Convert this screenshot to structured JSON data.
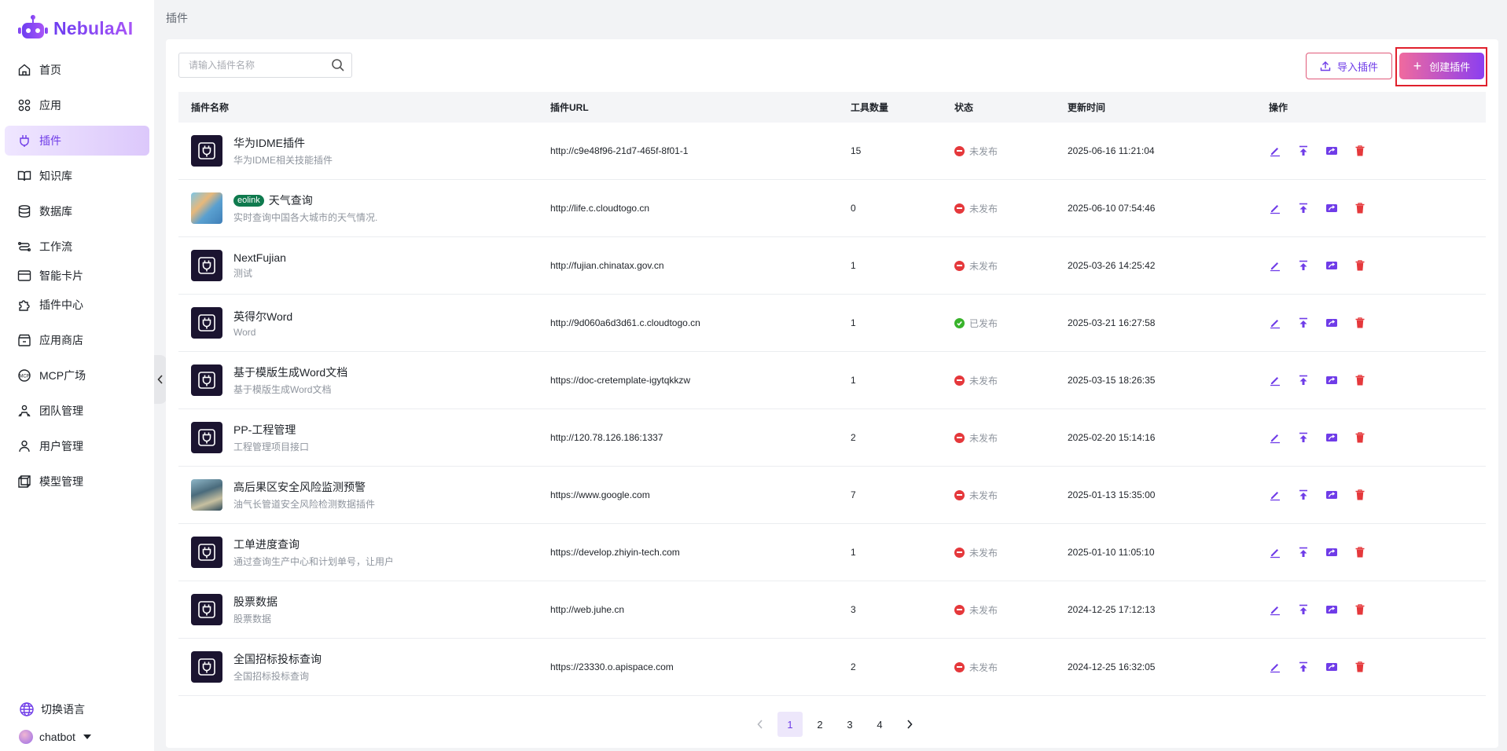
{
  "app": {
    "logo_text": "NebulaAI",
    "breadcrumb": "插件"
  },
  "sidebar": {
    "items": [
      {
        "label": "首页",
        "icon": "home-icon"
      },
      {
        "label": "应用",
        "icon": "apps-icon"
      },
      {
        "label": "插件",
        "icon": "plugin-icon",
        "active": true
      },
      {
        "label": "知识库",
        "icon": "book-icon"
      },
      {
        "label": "数据库",
        "icon": "database-icon"
      },
      {
        "label": "工作流",
        "icon": "workflow-icon"
      },
      {
        "label": "智能卡片",
        "icon": "card-icon"
      },
      {
        "label": "插件中心",
        "icon": "puzzle-icon"
      },
      {
        "label": "应用商店",
        "icon": "store-icon"
      },
      {
        "label": "MCP广场",
        "icon": "mcp-icon"
      },
      {
        "label": "团队管理",
        "icon": "team-icon"
      },
      {
        "label": "用户管理",
        "icon": "user-icon"
      },
      {
        "label": "模型管理",
        "icon": "model-icon"
      }
    ],
    "language": "切换语言",
    "user": "chatbot"
  },
  "toolbar": {
    "search_placeholder": "请输入插件名称",
    "import_label": "导入插件",
    "create_label": "创建插件"
  },
  "table": {
    "headers": {
      "name": "插件名称",
      "url": "插件URL",
      "tools": "工具数量",
      "status": "状态",
      "updated": "更新时间",
      "ops": "操作"
    },
    "rows": [
      {
        "title": "华为IDME插件",
        "desc": "华为IDME相关技能插件",
        "url": "http://c9e48f96-21d7-465f-8f01-1",
        "tools": "15",
        "status": "未发布",
        "published": false,
        "updated": "2025-06-16 11:21:04",
        "icon": "plugin"
      },
      {
        "title": "天气查询",
        "tag": "eolink",
        "desc": "实时查询中国各大城市的天气情况.",
        "url": "http://life.c.cloudtogo.cn",
        "tools": "0",
        "status": "未发布",
        "published": false,
        "updated": "2025-06-10 07:54:46",
        "icon": "weather"
      },
      {
        "title": "NextFujian",
        "desc": "测试",
        "url": "http://fujian.chinatax.gov.cn",
        "tools": "1",
        "status": "未发布",
        "published": false,
        "updated": "2025-03-26 14:25:42",
        "icon": "plugin"
      },
      {
        "title": "英得尔Word",
        "desc": "Word",
        "url": "http://9d060a6d3d61.c.cloudtogo.cn",
        "tools": "1",
        "status": "已发布",
        "published": true,
        "updated": "2025-03-21 16:27:58",
        "icon": "plugin"
      },
      {
        "title": "基于模版生成Word文档",
        "desc": "基于模版生成Word文档",
        "url": "https://doc-cretemplate-igytqkkzw",
        "tools": "1",
        "status": "未发布",
        "published": false,
        "updated": "2025-03-15 18:26:35",
        "icon": "plugin"
      },
      {
        "title": "PP-工程管理",
        "desc": "工程管理项目接口",
        "url": "http://120.78.126.186:1337",
        "tools": "2",
        "status": "未发布",
        "published": false,
        "updated": "2025-02-20 15:14:16",
        "icon": "plugin"
      },
      {
        "title": "高后果区安全风险监测预警",
        "desc": "油气长管道安全风险检测数据插件",
        "url": "https://www.google.com",
        "tools": "7",
        "status": "未发布",
        "published": false,
        "updated": "2025-01-13 15:35:00",
        "icon": "safety"
      },
      {
        "title": "工单进度查询",
        "desc": "通过查询生产中心和计划单号，让用户",
        "url": "https://develop.zhiyin-tech.com",
        "tools": "1",
        "status": "未发布",
        "published": false,
        "updated": "2025-01-10 11:05:10",
        "icon": "plugin"
      },
      {
        "title": "股票数据",
        "desc": "股票数据",
        "url": "http://web.juhe.cn",
        "tools": "3",
        "status": "未发布",
        "published": false,
        "updated": "2024-12-25 17:12:13",
        "icon": "plugin"
      },
      {
        "title": "全国招标投标查询",
        "desc": "全国招标投标查询",
        "url": "https://23330.o.apispace.com",
        "tools": "2",
        "status": "未发布",
        "published": false,
        "updated": "2024-12-25 16:32:05",
        "icon": "plugin"
      }
    ]
  },
  "pagination": {
    "pages": [
      "1",
      "2",
      "3",
      "4"
    ],
    "current": "1"
  },
  "colors": {
    "accent": "#6f3ce8",
    "danger": "#e5383b",
    "success": "#38b32b",
    "highlight_outline": "#e0202c"
  }
}
